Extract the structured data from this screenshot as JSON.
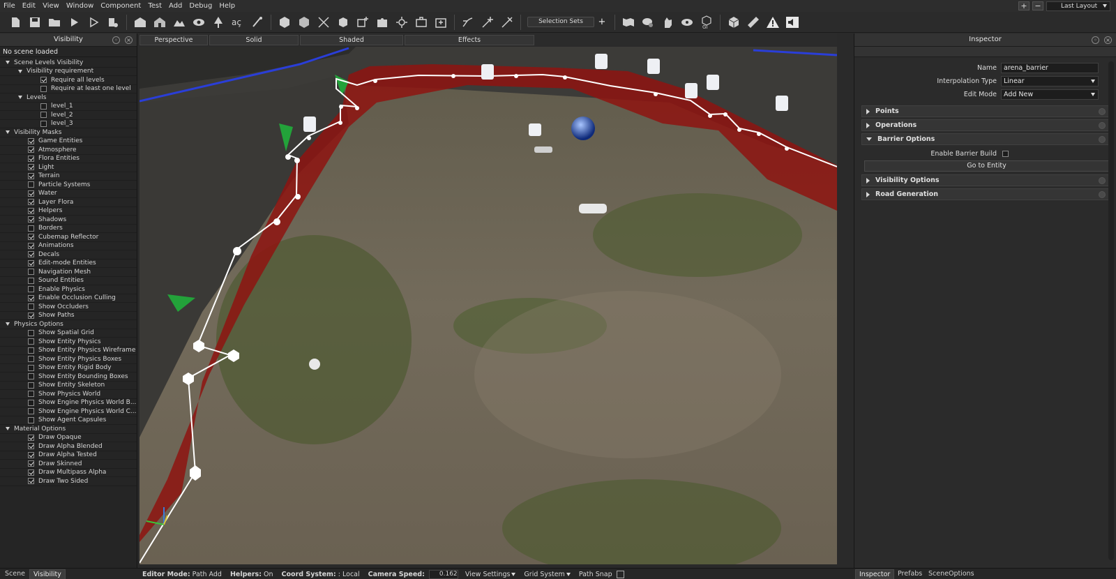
{
  "menu": [
    "File",
    "Edit",
    "View",
    "Window",
    "Component",
    "Test",
    "Add",
    "Debug",
    "Help"
  ],
  "layout": {
    "plus": "+",
    "minus": "−",
    "label": "Last Layout"
  },
  "toolbar": {
    "selection_sets": "Selection Sets",
    "selection_sets_add": "+",
    "ai_label": "GI"
  },
  "visibility_panel": {
    "title": "Visibility",
    "no_scene": "No scene loaded",
    "groups": {
      "scene_levels": "Scene Levels Visibility",
      "vis_req": "Visibility requirement",
      "require_all": "Require all levels",
      "require_one": "Require at least one level",
      "levels": "Levels",
      "level_1": "level_1",
      "level_2": "level_2",
      "level_3": "level_3",
      "masks": "Visibility Masks",
      "physics": "Physics Options",
      "material": "Material Options"
    },
    "masks": [
      {
        "label": "Game Entities",
        "on": true
      },
      {
        "label": "Atmosphere",
        "on": true
      },
      {
        "label": "Flora Entities",
        "on": true
      },
      {
        "label": "Light",
        "on": true
      },
      {
        "label": "Terrain",
        "on": true
      },
      {
        "label": "Particle Systems",
        "on": false
      },
      {
        "label": "Water",
        "on": true
      },
      {
        "label": "Layer Flora",
        "on": true
      },
      {
        "label": "Helpers",
        "on": true
      },
      {
        "label": "Shadows",
        "on": true
      },
      {
        "label": "Borders",
        "on": false
      },
      {
        "label": "Cubemap Reflector",
        "on": true
      },
      {
        "label": "Animations",
        "on": true
      },
      {
        "label": "Decals",
        "on": true
      },
      {
        "label": "Edit-mode Entities",
        "on": true
      },
      {
        "label": "Navigation Mesh",
        "on": false
      },
      {
        "label": "Sound Entities",
        "on": false
      },
      {
        "label": "Enable Physics",
        "on": false
      },
      {
        "label": "Enable Occlusion Culling",
        "on": true
      },
      {
        "label": "Show Occluders",
        "on": false
      },
      {
        "label": "Show Paths",
        "on": true
      }
    ],
    "physics": [
      {
        "label": "Show Spatial Grid",
        "on": false
      },
      {
        "label": "Show Entity Physics",
        "on": false
      },
      {
        "label": "Show Entity Physics Wireframe",
        "on": false
      },
      {
        "label": "Show Entity Physics Boxes",
        "on": false
      },
      {
        "label": "Show Entity Rigid Body",
        "on": false
      },
      {
        "label": "Show Entity Bounding Boxes",
        "on": false
      },
      {
        "label": "Show Entity Skeleton",
        "on": false
      },
      {
        "label": "Show Physics World",
        "on": false
      },
      {
        "label": "Show Engine Physics World B...",
        "on": false
      },
      {
        "label": "Show Engine Physics World C...",
        "on": false
      },
      {
        "label": "Show Agent Capsules",
        "on": false
      }
    ],
    "material": [
      {
        "label": "Draw Opaque",
        "on": true
      },
      {
        "label": "Draw Alpha Blended",
        "on": true
      },
      {
        "label": "Draw Alpha Tested",
        "on": true
      },
      {
        "label": "Draw Skinned",
        "on": true
      },
      {
        "label": "Draw Multipass Alpha",
        "on": true
      },
      {
        "label": "Draw Two Sided",
        "on": true
      }
    ]
  },
  "view_tabs": [
    "Perspective",
    "Solid",
    "Shaded",
    "Effects"
  ],
  "inspector": {
    "title": "Inspector",
    "name_label": "Name",
    "name_value": "arena_barrier",
    "interp_label": "Interpolation Type",
    "interp_value": "Linear",
    "edit_label": "Edit Mode",
    "edit_value": "Add New",
    "sections": {
      "points": "Points",
      "operations": "Operations",
      "barrier": "Barrier Options",
      "visibility": "Visibility Options",
      "road": "Road Generation"
    },
    "enable_barrier_label": "Enable Barrier Build",
    "goto_entity": "Go to Entity"
  },
  "bottom_left_tabs": [
    "Scene",
    "Visibility"
  ],
  "bottom_right_tabs": [
    "Inspector",
    "Prefabs",
    "SceneOptions"
  ],
  "status": {
    "editor_mode_label": "Editor Mode:",
    "editor_mode_value": "Path Add",
    "helpers_label": "Helpers:",
    "helpers_value": "On",
    "coord_label": "Coord System:",
    "coord_value": ": Local",
    "camera_speed_label": "Camera Speed:",
    "camera_speed_value": "0.162",
    "view_settings": "View Settings",
    "grid_system": "Grid System",
    "path_snap": "Path Snap"
  },
  "colors": {
    "barrier_red": "#8e1410",
    "path_white": "#ffffff",
    "ground": "#6b6456"
  }
}
